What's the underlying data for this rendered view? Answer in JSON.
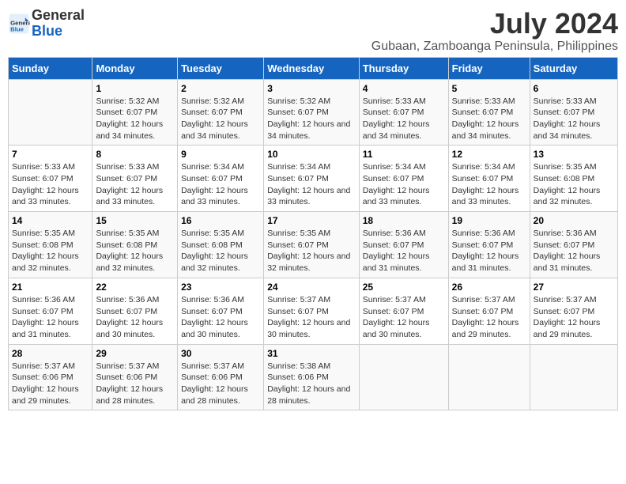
{
  "logo": {
    "general": "General",
    "blue": "Blue"
  },
  "title": "July 2024",
  "subtitle": "Gubaan, Zamboanga Peninsula, Philippines",
  "days_header": [
    "Sunday",
    "Monday",
    "Tuesday",
    "Wednesday",
    "Thursday",
    "Friday",
    "Saturday"
  ],
  "weeks": [
    [
      {
        "day": "",
        "sunrise": "",
        "sunset": "",
        "daylight": ""
      },
      {
        "day": "1",
        "sunrise": "Sunrise: 5:32 AM",
        "sunset": "Sunset: 6:07 PM",
        "daylight": "Daylight: 12 hours and 34 minutes."
      },
      {
        "day": "2",
        "sunrise": "Sunrise: 5:32 AM",
        "sunset": "Sunset: 6:07 PM",
        "daylight": "Daylight: 12 hours and 34 minutes."
      },
      {
        "day": "3",
        "sunrise": "Sunrise: 5:32 AM",
        "sunset": "Sunset: 6:07 PM",
        "daylight": "Daylight: 12 hours and 34 minutes."
      },
      {
        "day": "4",
        "sunrise": "Sunrise: 5:33 AM",
        "sunset": "Sunset: 6:07 PM",
        "daylight": "Daylight: 12 hours and 34 minutes."
      },
      {
        "day": "5",
        "sunrise": "Sunrise: 5:33 AM",
        "sunset": "Sunset: 6:07 PM",
        "daylight": "Daylight: 12 hours and 34 minutes."
      },
      {
        "day": "6",
        "sunrise": "Sunrise: 5:33 AM",
        "sunset": "Sunset: 6:07 PM",
        "daylight": "Daylight: 12 hours and 34 minutes."
      }
    ],
    [
      {
        "day": "7",
        "sunrise": "Sunrise: 5:33 AM",
        "sunset": "Sunset: 6:07 PM",
        "daylight": "Daylight: 12 hours and 33 minutes."
      },
      {
        "day": "8",
        "sunrise": "Sunrise: 5:33 AM",
        "sunset": "Sunset: 6:07 PM",
        "daylight": "Daylight: 12 hours and 33 minutes."
      },
      {
        "day": "9",
        "sunrise": "Sunrise: 5:34 AM",
        "sunset": "Sunset: 6:07 PM",
        "daylight": "Daylight: 12 hours and 33 minutes."
      },
      {
        "day": "10",
        "sunrise": "Sunrise: 5:34 AM",
        "sunset": "Sunset: 6:07 PM",
        "daylight": "Daylight: 12 hours and 33 minutes."
      },
      {
        "day": "11",
        "sunrise": "Sunrise: 5:34 AM",
        "sunset": "Sunset: 6:07 PM",
        "daylight": "Daylight: 12 hours and 33 minutes."
      },
      {
        "day": "12",
        "sunrise": "Sunrise: 5:34 AM",
        "sunset": "Sunset: 6:07 PM",
        "daylight": "Daylight: 12 hours and 33 minutes."
      },
      {
        "day": "13",
        "sunrise": "Sunrise: 5:35 AM",
        "sunset": "Sunset: 6:08 PM",
        "daylight": "Daylight: 12 hours and 32 minutes."
      }
    ],
    [
      {
        "day": "14",
        "sunrise": "Sunrise: 5:35 AM",
        "sunset": "Sunset: 6:08 PM",
        "daylight": "Daylight: 12 hours and 32 minutes."
      },
      {
        "day": "15",
        "sunrise": "Sunrise: 5:35 AM",
        "sunset": "Sunset: 6:08 PM",
        "daylight": "Daylight: 12 hours and 32 minutes."
      },
      {
        "day": "16",
        "sunrise": "Sunrise: 5:35 AM",
        "sunset": "Sunset: 6:08 PM",
        "daylight": "Daylight: 12 hours and 32 minutes."
      },
      {
        "day": "17",
        "sunrise": "Sunrise: 5:35 AM",
        "sunset": "Sunset: 6:07 PM",
        "daylight": "Daylight: 12 hours and 32 minutes."
      },
      {
        "day": "18",
        "sunrise": "Sunrise: 5:36 AM",
        "sunset": "Sunset: 6:07 PM",
        "daylight": "Daylight: 12 hours and 31 minutes."
      },
      {
        "day": "19",
        "sunrise": "Sunrise: 5:36 AM",
        "sunset": "Sunset: 6:07 PM",
        "daylight": "Daylight: 12 hours and 31 minutes."
      },
      {
        "day": "20",
        "sunrise": "Sunrise: 5:36 AM",
        "sunset": "Sunset: 6:07 PM",
        "daylight": "Daylight: 12 hours and 31 minutes."
      }
    ],
    [
      {
        "day": "21",
        "sunrise": "Sunrise: 5:36 AM",
        "sunset": "Sunset: 6:07 PM",
        "daylight": "Daylight: 12 hours and 31 minutes."
      },
      {
        "day": "22",
        "sunrise": "Sunrise: 5:36 AM",
        "sunset": "Sunset: 6:07 PM",
        "daylight": "Daylight: 12 hours and 30 minutes."
      },
      {
        "day": "23",
        "sunrise": "Sunrise: 5:36 AM",
        "sunset": "Sunset: 6:07 PM",
        "daylight": "Daylight: 12 hours and 30 minutes."
      },
      {
        "day": "24",
        "sunrise": "Sunrise: 5:37 AM",
        "sunset": "Sunset: 6:07 PM",
        "daylight": "Daylight: 12 hours and 30 minutes."
      },
      {
        "day": "25",
        "sunrise": "Sunrise: 5:37 AM",
        "sunset": "Sunset: 6:07 PM",
        "daylight": "Daylight: 12 hours and 30 minutes."
      },
      {
        "day": "26",
        "sunrise": "Sunrise: 5:37 AM",
        "sunset": "Sunset: 6:07 PM",
        "daylight": "Daylight: 12 hours and 29 minutes."
      },
      {
        "day": "27",
        "sunrise": "Sunrise: 5:37 AM",
        "sunset": "Sunset: 6:07 PM",
        "daylight": "Daylight: 12 hours and 29 minutes."
      }
    ],
    [
      {
        "day": "28",
        "sunrise": "Sunrise: 5:37 AM",
        "sunset": "Sunset: 6:06 PM",
        "daylight": "Daylight: 12 hours and 29 minutes."
      },
      {
        "day": "29",
        "sunrise": "Sunrise: 5:37 AM",
        "sunset": "Sunset: 6:06 PM",
        "daylight": "Daylight: 12 hours and 28 minutes."
      },
      {
        "day": "30",
        "sunrise": "Sunrise: 5:37 AM",
        "sunset": "Sunset: 6:06 PM",
        "daylight": "Daylight: 12 hours and 28 minutes."
      },
      {
        "day": "31",
        "sunrise": "Sunrise: 5:38 AM",
        "sunset": "Sunset: 6:06 PM",
        "daylight": "Daylight: 12 hours and 28 minutes."
      },
      {
        "day": "",
        "sunrise": "",
        "sunset": "",
        "daylight": ""
      },
      {
        "day": "",
        "sunrise": "",
        "sunset": "",
        "daylight": ""
      },
      {
        "day": "",
        "sunrise": "",
        "sunset": "",
        "daylight": ""
      }
    ]
  ]
}
